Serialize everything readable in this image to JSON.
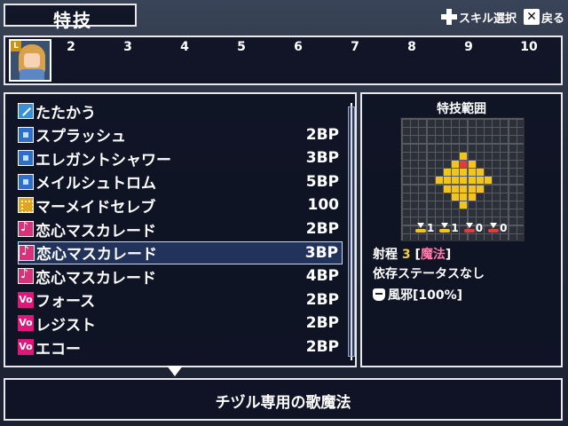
{
  "title": "特技",
  "hints": {
    "skill_select": "スキル選択",
    "back": "戻る"
  },
  "slots": {
    "leader_tag": "L",
    "numbers": [
      "2",
      "3",
      "4",
      "5",
      "6",
      "7",
      "8",
      "9",
      "10"
    ]
  },
  "skills": [
    {
      "name": "たたかう",
      "cost": "",
      "icon": "sword-icon"
    },
    {
      "name": "スプラッシュ",
      "cost": "2BP",
      "icon": "water-icon"
    },
    {
      "name": "エレガントシャワー",
      "cost": "3BP",
      "icon": "water-icon"
    },
    {
      "name": "メイルシュトロム",
      "cost": "5BP",
      "icon": "water-icon"
    },
    {
      "name": "マーメイドセレブ",
      "cost": "100",
      "icon": "gold-icon"
    },
    {
      "name": "恋心マスカレード",
      "cost": "2BP",
      "icon": "music-icon"
    },
    {
      "name": "恋心マスカレード",
      "cost": "3BP",
      "icon": "music-icon"
    },
    {
      "name": "恋心マスカレード",
      "cost": "4BP",
      "icon": "music-icon"
    },
    {
      "name": "フォース",
      "cost": "2BP",
      "icon": "vo-icon"
    },
    {
      "name": "レジスト",
      "cost": "2BP",
      "icon": "vo-icon"
    },
    {
      "name": "エコー",
      "cost": "2BP",
      "icon": "vo-icon"
    }
  ],
  "selected_index": 6,
  "vo_icon_text": "Vo",
  "info": {
    "range_title": "特技範囲",
    "mods": [
      "1",
      "1",
      "0",
      "0"
    ],
    "range_label": "射程",
    "range_value": "3",
    "bracket_open": "[",
    "bracket_close": "]",
    "range_type": "魔法",
    "dependency": "依存ステータスなし",
    "status_effect": "風邪[100%]"
  },
  "description": "チヅル専用の歌魔法",
  "colors": {
    "accent_yellow": "#f0d040",
    "accent_pink": "#ff7aa8",
    "range_center": "#e23b3b",
    "range_area": "#f2c41c"
  }
}
